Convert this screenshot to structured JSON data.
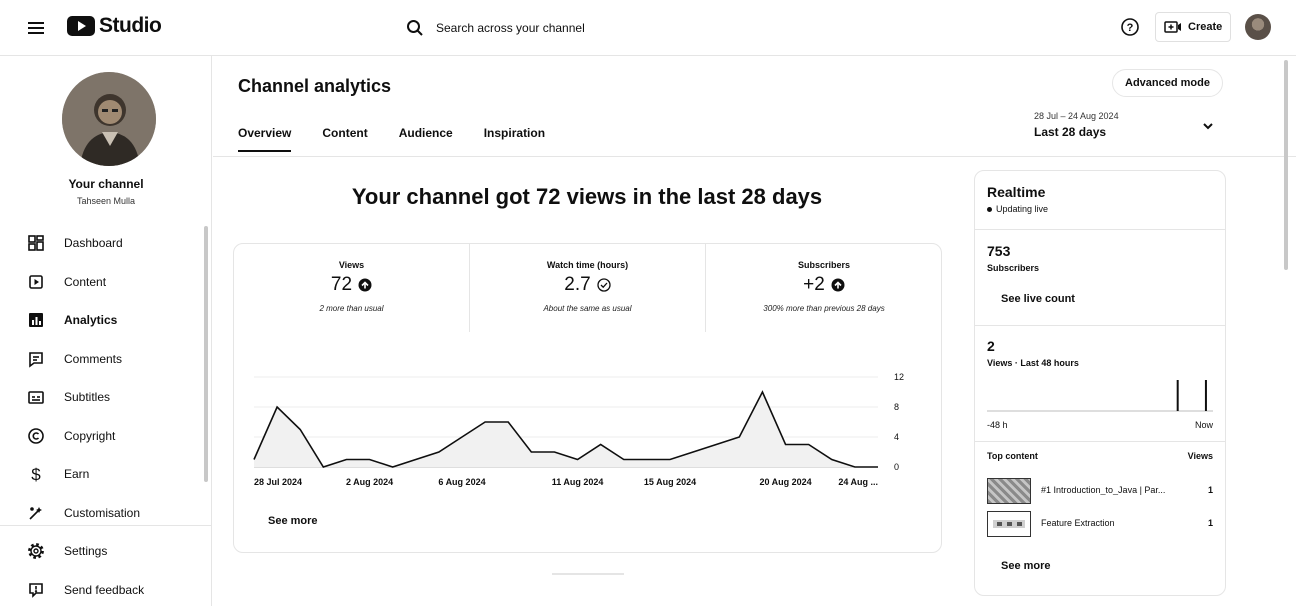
{
  "app": {
    "logo_text": "Studio"
  },
  "search": {
    "placeholder": "Search across your channel"
  },
  "header": {
    "create_label": "Create"
  },
  "sidebar": {
    "channel_title": "Your channel",
    "channel_name": "Tahseen Mulla",
    "items": [
      {
        "label": "Dashboard",
        "icon": "dashboard-icon"
      },
      {
        "label": "Content",
        "icon": "content-icon"
      },
      {
        "label": "Analytics",
        "icon": "analytics-icon",
        "active": true
      },
      {
        "label": "Comments",
        "icon": "comments-icon"
      },
      {
        "label": "Subtitles",
        "icon": "subtitles-icon"
      },
      {
        "label": "Copyright",
        "icon": "copyright-icon"
      },
      {
        "label": "Earn",
        "icon": "earn-icon"
      },
      {
        "label": "Customisation",
        "icon": "customisation-icon"
      }
    ],
    "bottom_items": [
      {
        "label": "Settings",
        "icon": "settings-icon"
      },
      {
        "label": "Send feedback",
        "icon": "feedback-icon"
      }
    ]
  },
  "main": {
    "title": "Channel analytics",
    "advanced_mode_label": "Advanced mode",
    "tabs": [
      {
        "label": "Overview",
        "active": true
      },
      {
        "label": "Content"
      },
      {
        "label": "Audience"
      },
      {
        "label": "Inspiration"
      }
    ],
    "date_range": {
      "range": "28 Jul – 24 Aug 2024",
      "label": "Last 28 days"
    },
    "headline": "Your channel got 72 views in the last 28 days",
    "metrics": [
      {
        "label": "Views",
        "value": "72",
        "icon": "arrow-up-circle-icon",
        "note": "2 more than usual"
      },
      {
        "label": "Watch time (hours)",
        "value": "2.7",
        "icon": "check-circle-icon",
        "note": "About the same as usual"
      },
      {
        "label": "Subscribers",
        "value": "+2",
        "icon": "arrow-up-circle-icon",
        "note": "300% more than previous 28 days"
      }
    ],
    "see_more_label": "See more"
  },
  "chart_data": {
    "type": "area",
    "metric": "Views",
    "x_tick_labels": [
      "28 Jul 2024",
      "2 Aug 2024",
      "6 Aug 2024",
      "11 Aug 2024",
      "15 Aug 2024",
      "20 Aug 2024",
      "24 Aug ..."
    ],
    "y_ticks": [
      0,
      4,
      8,
      12
    ],
    "ylim": [
      0,
      12
    ],
    "x_days": [
      "28 Jul",
      "29 Jul",
      "30 Jul",
      "31 Jul",
      "1 Aug",
      "2 Aug",
      "3 Aug",
      "4 Aug",
      "5 Aug",
      "6 Aug",
      "7 Aug",
      "8 Aug",
      "9 Aug",
      "10 Aug",
      "11 Aug",
      "12 Aug",
      "13 Aug",
      "14 Aug",
      "15 Aug",
      "16 Aug",
      "17 Aug",
      "18 Aug",
      "19 Aug",
      "20 Aug",
      "21 Aug",
      "22 Aug",
      "23 Aug",
      "24 Aug"
    ],
    "values": [
      1,
      8,
      5,
      0,
      1,
      1,
      0,
      1,
      2,
      4,
      6,
      6,
      2,
      2,
      1,
      3,
      1,
      1,
      1,
      2,
      3,
      4,
      10,
      3,
      3,
      1,
      0,
      0
    ],
    "grid": true,
    "y_axis_position": "right"
  },
  "realtime": {
    "title": "Realtime",
    "status": "Updating live",
    "subscribers_value": "753",
    "subscribers_label": "Subscribers",
    "see_live_count_label": "See live count",
    "views_value": "2",
    "views_label": "Views · Last 48 hours",
    "axis_start": "-48 h",
    "axis_end": "Now",
    "bars": [
      0,
      0,
      0,
      0,
      0,
      0,
      0,
      0,
      0,
      0,
      0,
      0,
      0,
      0,
      0,
      0,
      0,
      0,
      0,
      0,
      0,
      0,
      0,
      0,
      0,
      0,
      0,
      0,
      0,
      0,
      0,
      0,
      0,
      0,
      0,
      0,
      0,
      0,
      0,
      0,
      1,
      0,
      0,
      0,
      0,
      0,
      1,
      0
    ],
    "top_content_label": "Top content",
    "top_content_views_label": "Views",
    "top_content": [
      {
        "title": "#1 Introduction_to_Java | Par...",
        "views": "1"
      },
      {
        "title": "Feature Extraction",
        "views": "1"
      }
    ],
    "see_more_label": "See more"
  }
}
